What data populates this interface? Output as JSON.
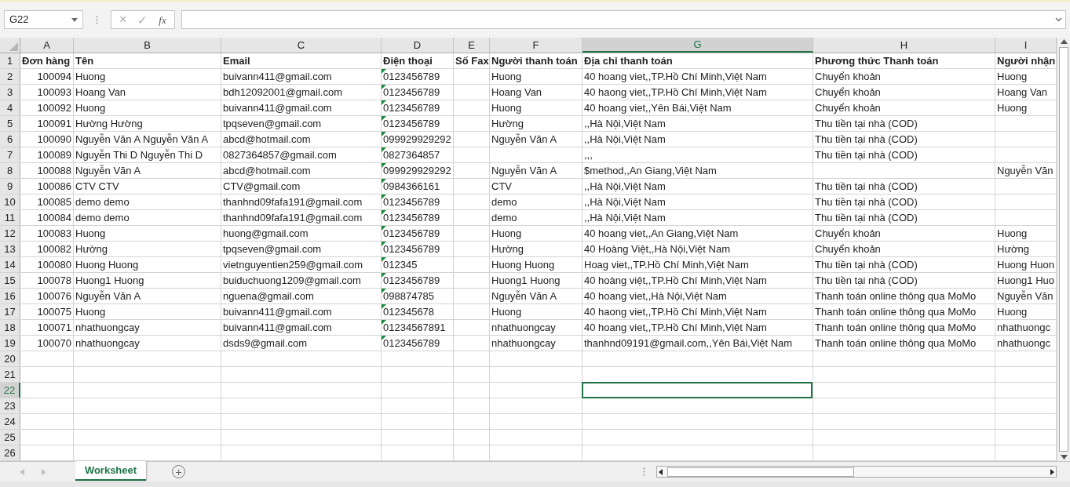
{
  "formula_bar": {
    "name_box": "G22",
    "cancel": "×",
    "enter": "✓",
    "function": "fx"
  },
  "columns": [
    {
      "label": "A",
      "selected": false
    },
    {
      "label": "B",
      "selected": false
    },
    {
      "label": "C",
      "selected": false
    },
    {
      "label": "D",
      "selected": false
    },
    {
      "label": "E",
      "selected": false
    },
    {
      "label": "F",
      "selected": false
    },
    {
      "label": "G",
      "selected": true
    },
    {
      "label": "H",
      "selected": false
    },
    {
      "label": "I",
      "selected": false
    }
  ],
  "rows": [
    {
      "row": "1",
      "selected": false,
      "flag": false,
      "cells": [
        "Đơn hàng",
        "Tên",
        "Email",
        "Điện thoại",
        "Số Fax",
        "Người thanh toán",
        "Địa chỉ thanh toán",
        "Phương thức Thanh toán",
        "Người nhận"
      ]
    },
    {
      "row": "2",
      "selected": false,
      "flag": true,
      "cells": [
        "100094",
        "Huong",
        "buivann411@gmail.com",
        "0123456789",
        "",
        "Huong",
        "40 hoang viet,,TP.Hồ Chí Minh,Việt Nam",
        "Chuyển khoản",
        "Huong"
      ]
    },
    {
      "row": "3",
      "selected": false,
      "flag": true,
      "cells": [
        "100093",
        "Hoang Van",
        "bdh12092001@gmail.com",
        "0123456789",
        "",
        "Hoang Van",
        "40 haong viet,,TP.Hồ Chí Minh,Việt Nam",
        "Chuyển khoản",
        "Hoang Van"
      ]
    },
    {
      "row": "4",
      "selected": false,
      "flag": true,
      "cells": [
        "100092",
        "Huong",
        "buivann411@gmail.com",
        "0123456789",
        "",
        "Huong",
        "40 hoang viet,,Yên Bái,Việt Nam",
        "Chuyển khoản",
        "Huong"
      ]
    },
    {
      "row": "5",
      "selected": false,
      "flag": true,
      "cells": [
        "100091",
        "Hường Hường",
        "tpqseven@gmail.com",
        "0123456789",
        "",
        "Hường",
        ",,Hà Nội,Việt Nam",
        "Thu tiền tại nhà (COD)",
        ""
      ]
    },
    {
      "row": "6",
      "selected": false,
      "flag": true,
      "cells": [
        "100090",
        "Nguyễn Văn A Nguyễn Văn A",
        "abcd@hotmail.com",
        "099929929292",
        "",
        "Nguyễn Văn A",
        ",,Hà Nội,Việt Nam",
        "Thu tiền tại nhà (COD)",
        ""
      ]
    },
    {
      "row": "7",
      "selected": false,
      "flag": true,
      "cells": [
        "100089",
        "Nguyễn Thi D Nguyễn Thi D",
        "0827364857@gmail.com",
        "0827364857",
        "",
        "",
        ",,,",
        "Thu tiền tại nhà (COD)",
        ""
      ]
    },
    {
      "row": "8",
      "selected": false,
      "flag": true,
      "cells": [
        "100088",
        "Nguyễn Văn A",
        "abcd@hotmail.com",
        "099929929292",
        "",
        "Nguyễn Văn A",
        "$method,,An Giang,Việt Nam",
        "",
        "Nguyễn Văn"
      ]
    },
    {
      "row": "9",
      "selected": false,
      "flag": true,
      "cells": [
        "100086",
        "CTV CTV",
        "CTV@gmail.com",
        "0984366161",
        "",
        "CTV",
        ",,Hà Nội,Việt Nam",
        "Thu tiền tại nhà (COD)",
        ""
      ]
    },
    {
      "row": "10",
      "selected": false,
      "flag": true,
      "cells": [
        "100085",
        "demo demo",
        "thanhnd09fafa191@gmail.com",
        "0123456789",
        "",
        "demo",
        ",,Hà Nội,Việt Nam",
        "Thu tiền tại nhà (COD)",
        ""
      ]
    },
    {
      "row": "11",
      "selected": false,
      "flag": true,
      "cells": [
        "100084",
        "demo demo",
        "thanhnd09fafa191@gmail.com",
        "0123456789",
        "",
        "demo",
        ",,Hà Nội,Việt Nam",
        "Thu tiền tại nhà (COD)",
        ""
      ]
    },
    {
      "row": "12",
      "selected": false,
      "flag": true,
      "cells": [
        "100083",
        "Huong",
        "huong@gmail.com",
        "0123456789",
        "",
        "Huong",
        "40 hoang viet,,An Giang,Việt Nam",
        "Chuyển khoản",
        "Huong"
      ]
    },
    {
      "row": "13",
      "selected": false,
      "flag": true,
      "cells": [
        "100082",
        "Hường",
        "tpqseven@gmail.com",
        "0123456789",
        "",
        "Hường",
        "40 Hoàng Việt,,Hà Nội,Việt Nam",
        "Chuyển khoản",
        "Hường"
      ]
    },
    {
      "row": "14",
      "selected": false,
      "flag": true,
      "cells": [
        "100080",
        "Huong Huong",
        "vietnguyentien259@gmail.com",
        "012345",
        "",
        "Huong Huong",
        "Hoag viet,,TP.Hồ Chí Minh,Việt Nam",
        "Thu tiền tại nhà (COD)",
        "Huong Huon"
      ]
    },
    {
      "row": "15",
      "selected": false,
      "flag": true,
      "cells": [
        "100078",
        "Huong1 Huong",
        "buiduchuong1209@gmail.com",
        "0123456789",
        "",
        "Huong1 Huong",
        "40 hoàng việt,,TP.Hồ Chí Minh,Việt Nam",
        "Thu tiền tại nhà (COD)",
        "Huong1 Huo"
      ]
    },
    {
      "row": "16",
      "selected": false,
      "flag": true,
      "cells": [
        "100076",
        "Nguyễn Văn A",
        "nguena@gmail.com",
        "098874785",
        "",
        "Nguyễn Văn A",
        "40 hoang viet,,Hà Nội,Việt Nam",
        "Thanh toán online thông qua MoMo",
        "Nguyễn Văn"
      ]
    },
    {
      "row": "17",
      "selected": false,
      "flag": true,
      "cells": [
        "100075",
        "Huong",
        "buivann411@gmail.com",
        "012345678",
        "",
        "Huong",
        "40 haong viet,,TP.Hồ Chí Minh,Việt Nam",
        "Thanh toán online thông qua MoMo",
        "Huong"
      ]
    },
    {
      "row": "18",
      "selected": false,
      "flag": true,
      "cells": [
        "100071",
        "nhathuongcay",
        "buivann411@gmail.com",
        "01234567891",
        "",
        "nhathuongcay",
        "40 hoang viet,,TP.Hồ Chí Minh,Việt Nam",
        "Thanh toán online thông qua MoMo",
        "nhathuongc"
      ]
    },
    {
      "row": "19",
      "selected": false,
      "flag": true,
      "cells": [
        "100070",
        "nhathuongcay",
        "dsds9@gmail.com",
        "0123456789",
        "",
        "nhathuongcay",
        "thanhnd09191@gmail.com,,Yên Bái,Việt Nam",
        "Thanh toán online thông qua MoMo",
        "nhathuongc"
      ]
    },
    {
      "row": "20",
      "selected": false,
      "flag": false,
      "cells": []
    },
    {
      "row": "21",
      "selected": false,
      "flag": false,
      "cells": []
    },
    {
      "row": "22",
      "selected": true,
      "flag": false,
      "cells": []
    },
    {
      "row": "23",
      "selected": false,
      "flag": false,
      "cells": []
    },
    {
      "row": "24",
      "selected": false,
      "flag": false,
      "cells": []
    },
    {
      "row": "25",
      "selected": false,
      "flag": false,
      "cells": []
    },
    {
      "row": "26",
      "selected": false,
      "flag": false,
      "cells": []
    }
  ],
  "sheet_tabs": [
    {
      "label": "Worksheet",
      "selected": true
    }
  ],
  "add_sheet": "+"
}
